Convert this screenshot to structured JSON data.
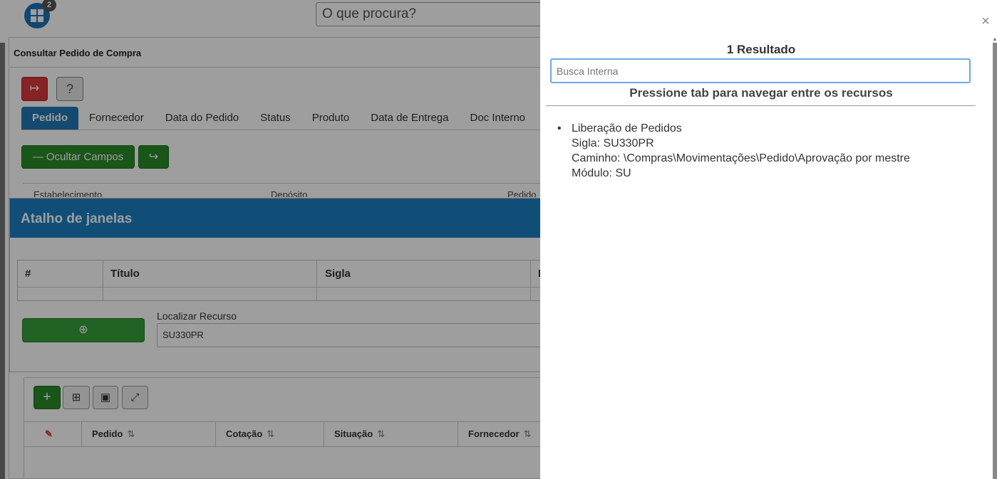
{
  "app": {
    "logo_badge": "2",
    "search_placeholder": "O que procura?",
    "page_title": "Consultar Pedido de Compra",
    "help_label": "?",
    "tabs": [
      {
        "label": "Pedido",
        "active": true
      },
      {
        "label": "Fornecedor"
      },
      {
        "label": "Data do Pedido"
      },
      {
        "label": "Status"
      },
      {
        "label": "Produto"
      },
      {
        "label": "Data de Entrega"
      },
      {
        "label": "Doc Interno"
      }
    ],
    "ocultar_label": "Ocultar Campos",
    "fields": [
      "Estabelecimento",
      "Depósito",
      "Pedido"
    ],
    "atalho": {
      "title": "Atalho de janelas",
      "columns": [
        "#",
        "Título",
        "Sigla",
        "I"
      ],
      "localizar_label": "Localizar Recurso",
      "localizar_value": "SU330PR"
    },
    "grid": {
      "columns": [
        "Pedido",
        "Cotação",
        "Situação",
        "Fornecedor"
      ]
    }
  },
  "side_panel": {
    "result_count": "1 Resultado",
    "search_placeholder": "Busca Interna",
    "hint": "Pressione tab para navegar entre os recursos",
    "results": [
      {
        "name": "Liberação de Pedidos",
        "sigla": "Sigla: SU330PR",
        "caminho": "Caminho: \\Compras\\Movimentações\\Pedido\\Aprovação por mestre",
        "modulo": "Módulo: SU"
      }
    ]
  }
}
